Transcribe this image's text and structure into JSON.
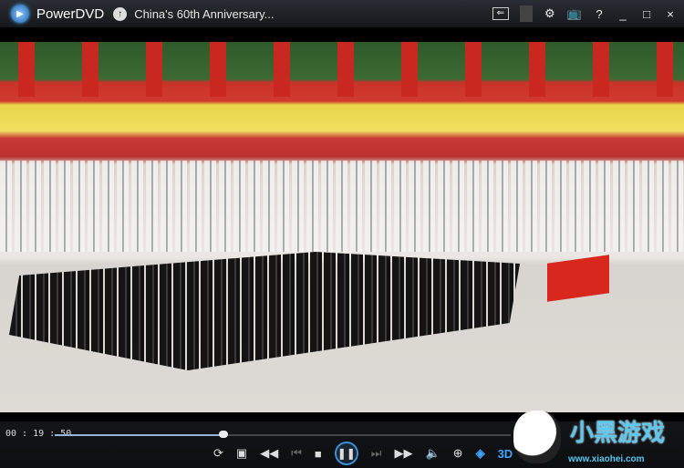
{
  "titlebar": {
    "app_name": "PowerDVD",
    "title": "China's 60th Anniversary...",
    "icons": [
      "powerdvd-logo-icon",
      "upload-icon",
      "back-to-library-icon",
      "settings-icon",
      "tv-mode-icon",
      "help-icon",
      "minimize-icon",
      "maximize-icon",
      "close-icon"
    ]
  },
  "titlebar_labels": {
    "help": "?",
    "minimize": "_",
    "maximize": "□",
    "close": "×"
  },
  "player": {
    "time": "00 : 19 : 50",
    "progress": 0.37,
    "threed_label": "3D"
  },
  "controls": {
    "icons": [
      "repeat-icon",
      "snapshot-icon",
      "rewind-icon",
      "previous-icon",
      "stop-icon",
      "pause-icon",
      "next-icon",
      "fast-forward-icon",
      "volume-icon",
      "zoom-icon",
      "trueview-eye-icon",
      "3d-icon"
    ]
  },
  "watermark": {
    "text": "小黑游戏",
    "url": "www.xiaohei.com"
  }
}
